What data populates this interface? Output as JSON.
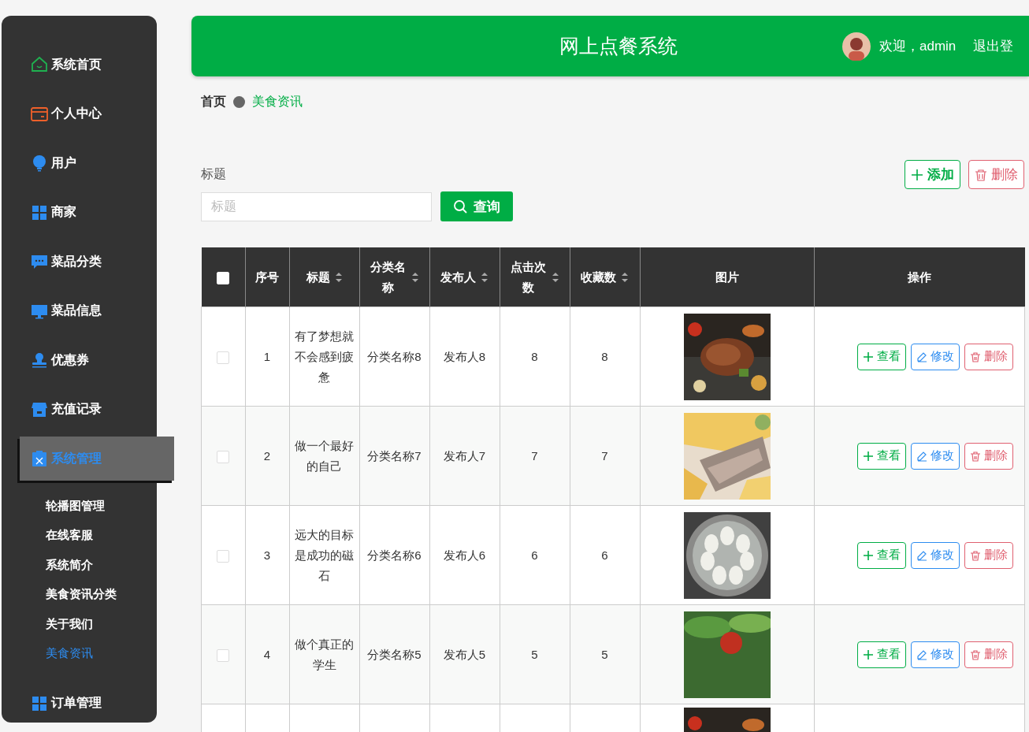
{
  "sidebar": {
    "items": [
      {
        "label": "系统首页",
        "selected": false
      },
      {
        "label": "个人中心",
        "selected": false
      },
      {
        "label": "用户",
        "selected": false
      },
      {
        "label": "商家",
        "selected": false
      },
      {
        "label": "菜品分类",
        "selected": false
      },
      {
        "label": "菜品信息",
        "selected": false
      },
      {
        "label": "优惠券",
        "selected": false
      },
      {
        "label": "充值记录",
        "selected": false
      },
      {
        "label": "系统管理",
        "selected": true,
        "expanded": true,
        "children": [
          {
            "label": "轮播图管理",
            "selected": false
          },
          {
            "label": "在线客服",
            "selected": false
          },
          {
            "label": "系统简介",
            "selected": false
          },
          {
            "label": "美食资讯分类",
            "selected": false
          },
          {
            "label": "关于我们",
            "selected": false
          },
          {
            "label": "美食资讯",
            "selected": true
          }
        ]
      },
      {
        "label": "订单管理",
        "selected": false
      }
    ]
  },
  "header": {
    "title": "网上点餐系统",
    "welcome": "欢迎，admin",
    "logout": "退出登"
  },
  "breadcrumb": [
    "首页",
    "美食资讯"
  ],
  "search": {
    "label": "标题",
    "placeholder": "标题",
    "button": "查询"
  },
  "actions": {
    "add": "添加",
    "delete": "删除"
  },
  "table": {
    "header_checkbox": {
      "checked": false
    },
    "columns": [
      {
        "label": "序号",
        "sortable": false
      },
      {
        "label": "标题",
        "sortable": true
      },
      {
        "label": "分类名称",
        "sortable": true
      },
      {
        "label": "发布人",
        "sortable": true
      },
      {
        "label": "点击次数",
        "sortable": true
      },
      {
        "label": "收藏数",
        "sortable": true
      },
      {
        "label": "图片",
        "sortable": false
      },
      {
        "label": "操作",
        "sortable": false
      }
    ],
    "rows": [
      {
        "kind": "full",
        "checked": false,
        "index": "1",
        "title": "有了梦想就不会感到疲惫",
        "category": "分类名称8",
        "publisher": "发布人8",
        "clicks": "8",
        "favorites": "8",
        "buttons": [
          "查看",
          "修改",
          "删除"
        ]
      },
      {
        "kind": "full",
        "checked": false,
        "index": "2",
        "title": "做一个最好的自己",
        "category": "分类名称7",
        "publisher": "发布人7",
        "clicks": "7",
        "favorites": "7",
        "buttons": [
          "查看",
          "修改",
          "删除"
        ]
      },
      {
        "kind": "full",
        "checked": false,
        "index": "3",
        "title": "远大的目标是成功的磁石",
        "category": "分类名称6",
        "publisher": "发布人6",
        "clicks": "6",
        "favorites": "6",
        "buttons": [
          "查看",
          "修改",
          "删除"
        ]
      },
      {
        "kind": "full",
        "checked": false,
        "index": "4",
        "title": "做个真正的学生",
        "category": "分类名称5",
        "publisher": "发布人5",
        "clicks": "5",
        "favorites": "5",
        "buttons": [
          "查看",
          "修改",
          "删除"
        ]
      },
      {
        "kind": "partial"
      }
    ]
  }
}
